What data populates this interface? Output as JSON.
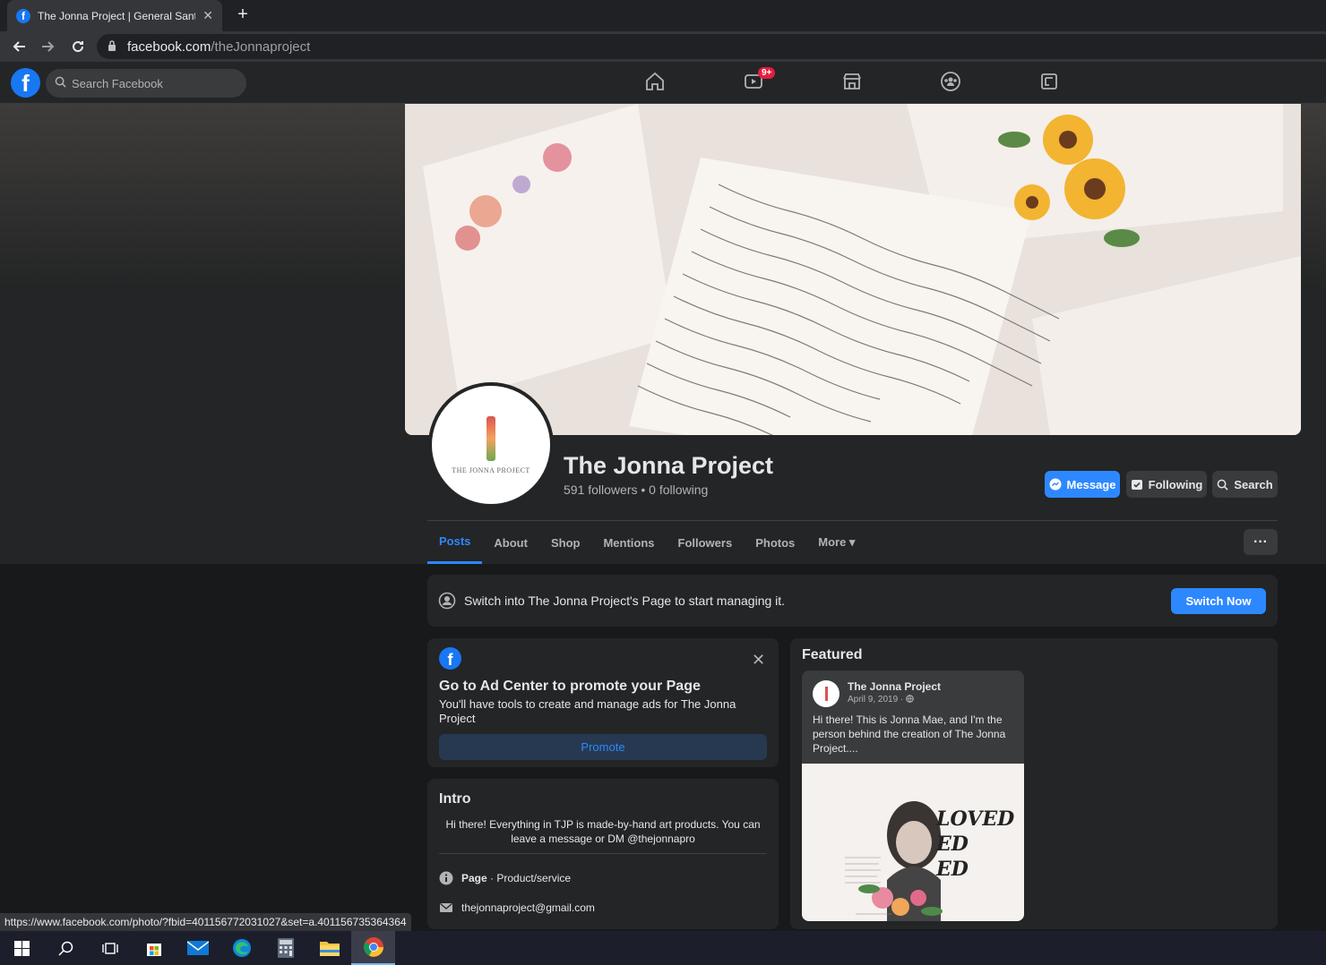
{
  "browser": {
    "tab_title": "The Jonna Project | General Santos",
    "url_host": "facebook.com",
    "url_path": "/theJonnaproject",
    "status_url": "https://www.facebook.com/photo/?fbid=401156772031027&set=a.401156735364364"
  },
  "fb": {
    "search_placeholder": "Search Facebook",
    "watch_badge": "9+"
  },
  "page": {
    "name": "The Jonna Project",
    "stats": "591 followers • 0 following",
    "avatar_text": "THE JONNA PROJECT",
    "actions": {
      "message": "Message",
      "following": "Following",
      "search": "Search"
    },
    "tabs": [
      "Posts",
      "About",
      "Shop",
      "Mentions",
      "Followers",
      "Photos",
      "More ▾"
    ],
    "more_button": "···"
  },
  "switch_bar": {
    "text": "Switch into The Jonna Project's Page to start managing it.",
    "button": "Switch Now"
  },
  "ad_card": {
    "heading": "Go to Ad Center to promote your Page",
    "body": "You'll have tools to create and manage ads for The Jonna Project",
    "button": "Promote"
  },
  "intro": {
    "heading": "Intro",
    "bio": "Hi there! Everything in TJP is made-by-hand art products. You can leave a message or DM @thejonnapro",
    "category_label": "Page",
    "category_value": " · Product/service",
    "email": "thejonnaproject@gmail.com"
  },
  "featured": {
    "heading": "Featured",
    "post_author": "The Jonna Project",
    "post_date": "April 9, 2019 · ",
    "post_text": "Hi there! This is Jonna Mae, and I'm the person behind the creation of The Jonna Project....",
    "image_text": "LOVED ED ED"
  },
  "colors": {
    "fb_blue": "#1877f2",
    "accent": "#2d88ff",
    "surface": "#242526",
    "background": "#18191a"
  }
}
